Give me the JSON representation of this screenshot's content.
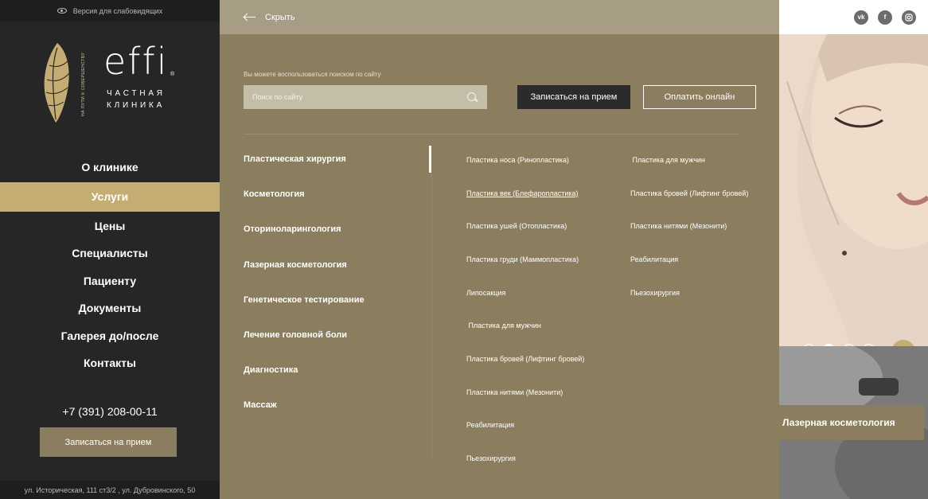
{
  "sidebar": {
    "accessibility_label": "Версия для слабовидящих",
    "logo": {
      "word": "effi",
      "reg": "®",
      "vertical_text": "НА ПУТИ К СОВЕРШЕНСТВУ",
      "line1": "ЧАСТНАЯ",
      "line2": "КЛИНИКА"
    },
    "menu": [
      {
        "label": "О клинике"
      },
      {
        "label": "Услуги"
      },
      {
        "label": "Цены"
      },
      {
        "label": "Специалисты"
      },
      {
        "label": "Пациенту"
      },
      {
        "label": "Документы"
      },
      {
        "label": "Галерея до/после"
      },
      {
        "label": "Контакты"
      }
    ],
    "phone": "+7 (391) 208-00-11",
    "book_button": "Записаться на прием",
    "address": "ул. Историческая, 111 ст3/2 , ул. Дубровинского, 50"
  },
  "overlay": {
    "hide_label": "Скрыть",
    "search_hint": "Вы можете воспользоваться поиском по сайту",
    "search_placeholder": "Поиск по сайту",
    "book_button": "Записаться на прием",
    "pay_button": "Оплатить онлайн",
    "categories": [
      {
        "label": "Пластическая хирургия"
      },
      {
        "label": "Косметология"
      },
      {
        "label": "Оториноларингология"
      },
      {
        "label": "Лазерная косметология"
      },
      {
        "label": "Генетическое тестирование"
      },
      {
        "label": "Лечение головной боли"
      },
      {
        "label": "Диагностика"
      },
      {
        "label": "Массаж"
      }
    ],
    "sub_col1": [
      {
        "label": "Пластика носа (Ринопластика)"
      },
      {
        "label": "Пластика век (Блефаропластика)"
      },
      {
        "label": "Пластика ушей (Отопластика)"
      },
      {
        "label": "Пластика груди (Маммопластика)"
      },
      {
        "label": "Липосакция"
      },
      {
        "label": " Пластика для мужчин"
      },
      {
        "label": "Пластика бровей (Лифтинг бровей)"
      },
      {
        "label": "Пластика нитями (Мезонити)"
      },
      {
        "label": "Реабилитация"
      },
      {
        "label": "Пьезохирургия"
      }
    ],
    "sub_col2": [
      {
        "label": " Пластика для мужчин"
      },
      {
        "label": "Пластика бровей (Лифтинг бровей)"
      },
      {
        "label": "Пластика нитями (Мезонити)"
      },
      {
        "label": "Реабилитация"
      },
      {
        "label": "Пьезохирургия"
      }
    ]
  },
  "right": {
    "social": [
      "vk",
      "f",
      "ig"
    ],
    "slider_active_dot": 2,
    "next_arrow": "→",
    "card_label": "Лазерная косметология"
  },
  "colors": {
    "gold": "#c4ac73",
    "panel": "#8b7e5e",
    "dark": "#262626"
  }
}
